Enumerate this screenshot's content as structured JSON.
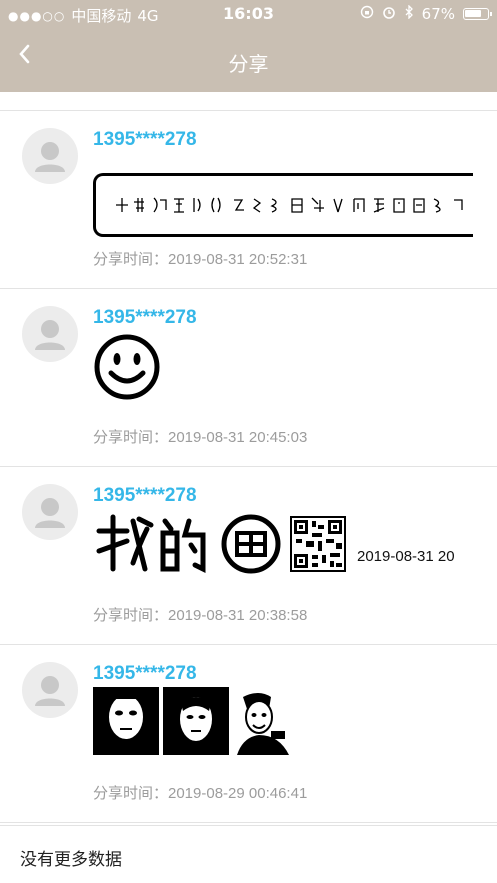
{
  "status_bar": {
    "carrier": "中国移动",
    "network": "4G",
    "time": "16:03",
    "battery": "67%"
  },
  "nav": {
    "title": "分享",
    "back_icon": "chevron-left-icon"
  },
  "posts": [
    {
      "username": "1395****278",
      "content_type": "seal-script-image",
      "share_time": "分享时间：2019-08-31 20:52:31"
    },
    {
      "username": "1395****278",
      "content_type": "smiley-face-image",
      "share_time": "分享时间：2019-08-31 20:45:03"
    },
    {
      "username": "1395****278",
      "content_type": "text-qr-image",
      "image_text": "2019-08-31 20",
      "share_time": "分享时间：2019-08-31 20:38:58"
    },
    {
      "username": "1395****278",
      "content_type": "portraits-image",
      "share_time": "分享时间：2019-08-29 00:46:41"
    }
  ],
  "footer": {
    "no_more": "没有更多数据"
  },
  "colors": {
    "header_bg": "#c9bfb3",
    "username": "#35b7e8",
    "time_text": "#9c9c9c",
    "divider": "#e3e3e3"
  }
}
